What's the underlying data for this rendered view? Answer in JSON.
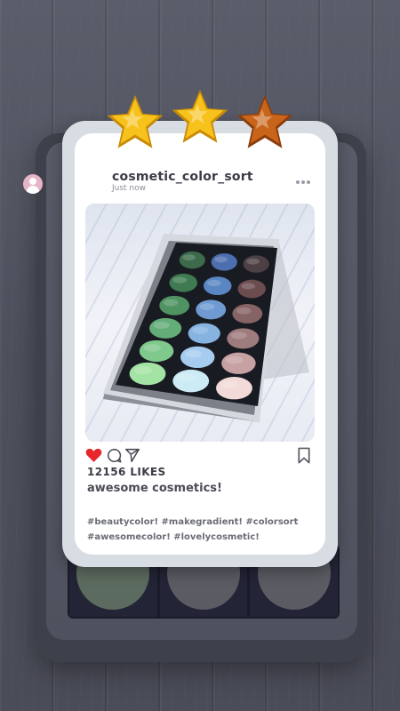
{
  "game": {
    "stars_earned": 3,
    "stars_total": 3,
    "star_colors": [
      "#f7c21b",
      "#f7c21b",
      "#c9651a"
    ]
  },
  "post": {
    "username": "cosmetic_color_sort",
    "timestamp": "Just now",
    "likes": "12156 LIKES",
    "caption": "awesome cosmetics!",
    "hashtags_line1": "#beautycolor!  #makegradient!  #colorsort",
    "hashtags_line2": "#awesomecolor!  #lovelycosmetic!",
    "liked": true
  },
  "palette": {
    "rows": [
      [
        "#3c6b4b",
        "#4d6fb0",
        "#4c4043"
      ],
      [
        "#3f7a52",
        "#5a86c3",
        "#6b4c4f"
      ],
      [
        "#4f9362",
        "#6f9bd2",
        "#866364"
      ],
      [
        "#63ad78",
        "#86b3e0",
        "#9e7b7c"
      ],
      [
        "#7fc98d",
        "#a6cdef",
        "#c7a2a3"
      ],
      [
        "#a3e3a3",
        "#ccebf5",
        "#f1dad8"
      ]
    ]
  },
  "background_palette": [
    "#5c6b5f",
    "#5a5b63",
    "#5b5c63"
  ],
  "icons": [
    "avatar-icon",
    "more-icon",
    "heart-icon",
    "comment-icon",
    "share-icon",
    "bookmark-icon",
    "star-icon"
  ]
}
